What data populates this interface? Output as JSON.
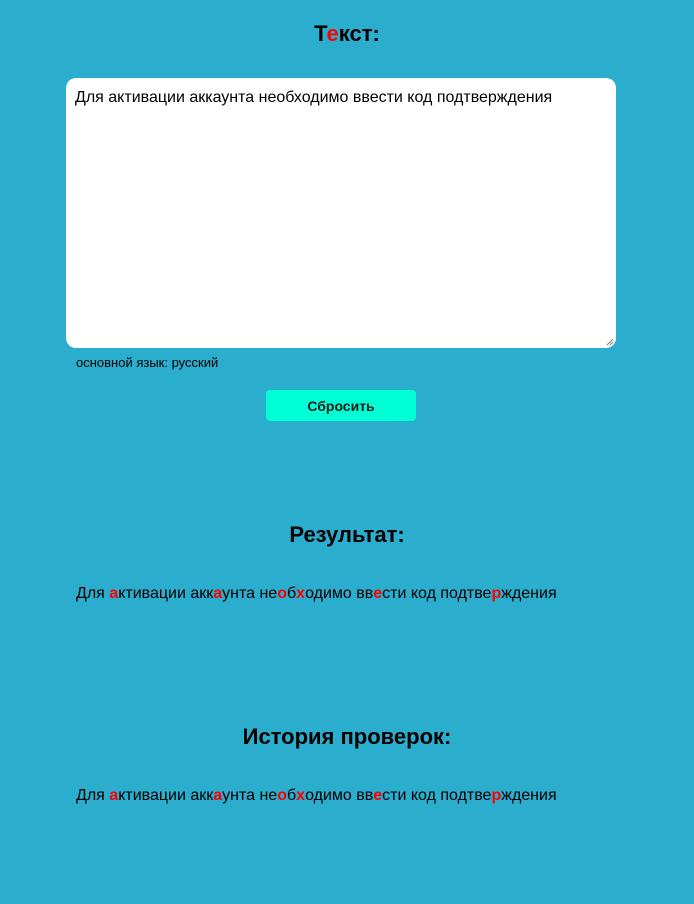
{
  "colors": {
    "background": "#2badcd",
    "textarea_bg": "#ffffff",
    "button_bg": "#00ffd5",
    "highlight": "#ff0000"
  },
  "input_section": {
    "title_parts": [
      {
        "text": "Т",
        "highlight": false
      },
      {
        "text": "е",
        "highlight": true
      },
      {
        "text": "кст:",
        "highlight": false
      }
    ],
    "textarea_value": "Для активации аккаунта необходимо ввести код подтверждения",
    "language_note": "основной язык: русский",
    "reset_label": "Сбросить"
  },
  "result_section": {
    "title": "Результат:",
    "segments": [
      {
        "text": "Для ",
        "highlight": false
      },
      {
        "text": "а",
        "highlight": true
      },
      {
        "text": "ктивации акк",
        "highlight": false
      },
      {
        "text": "а",
        "highlight": true
      },
      {
        "text": "унта не",
        "highlight": false
      },
      {
        "text": "о",
        "highlight": true
      },
      {
        "text": "б",
        "highlight": false
      },
      {
        "text": "х",
        "highlight": true
      },
      {
        "text": "одимо вв",
        "highlight": false
      },
      {
        "text": "е",
        "highlight": true
      },
      {
        "text": "сти код подтве",
        "highlight": false
      },
      {
        "text": "р",
        "highlight": true
      },
      {
        "text": "ждения",
        "highlight": false
      }
    ]
  },
  "history_section": {
    "title": "История проверок:",
    "entries": [
      {
        "segments": [
          {
            "text": "Для ",
            "highlight": false
          },
          {
            "text": "а",
            "highlight": true
          },
          {
            "text": "ктивации акк",
            "highlight": false
          },
          {
            "text": "а",
            "highlight": true
          },
          {
            "text": "унта не",
            "highlight": false
          },
          {
            "text": "о",
            "highlight": true
          },
          {
            "text": "б",
            "highlight": false
          },
          {
            "text": "х",
            "highlight": true
          },
          {
            "text": "одимо вв",
            "highlight": false
          },
          {
            "text": "е",
            "highlight": true
          },
          {
            "text": "сти код подтве",
            "highlight": false
          },
          {
            "text": "р",
            "highlight": true
          },
          {
            "text": "ждения",
            "highlight": false
          }
        ]
      }
    ]
  }
}
